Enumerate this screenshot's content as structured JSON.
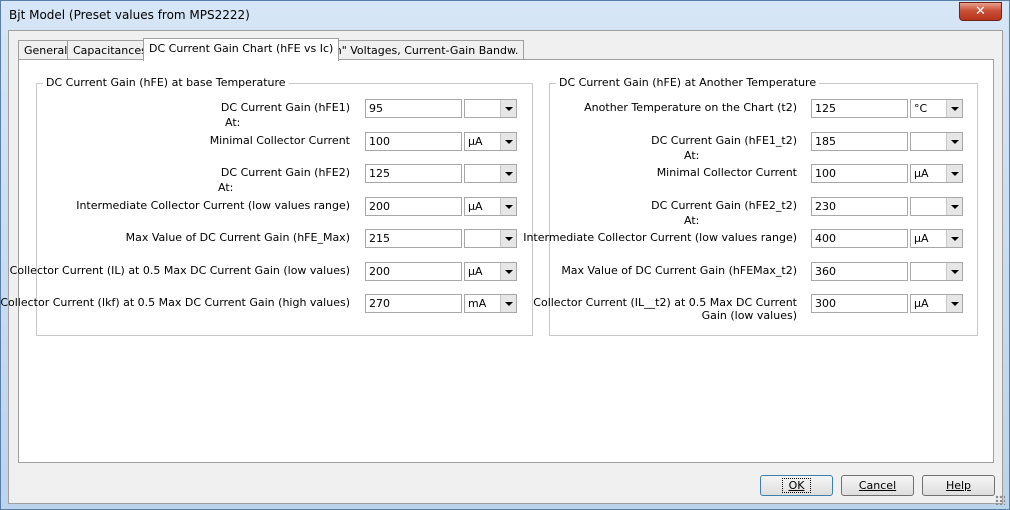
{
  "window": {
    "title": "Bjt Model (Preset values from MPS2222)",
    "close_glyph": "✕"
  },
  "tabs": [
    {
      "label": "General"
    },
    {
      "label": "Capacitances"
    },
    {
      "label": "DC Current Gain Chart (hFE vs Ic)"
    },
    {
      "label": "\"On\" Voltages, Current-Gain Bandw."
    }
  ],
  "left_group": {
    "title": "DC Current Gain (hFE) at base Temperature",
    "rows": [
      {
        "label": "DC Current Gain (hFE1)",
        "value": "95",
        "unit": ""
      },
      {
        "label": "Minimal Collector Current",
        "value": "100",
        "unit": "µA"
      },
      {
        "label": "DC Current Gain (hFE2)",
        "value": "125",
        "unit": ""
      },
      {
        "label": "Intermediate Collector Current (low values range)",
        "value": "200",
        "unit": "µA"
      },
      {
        "label": "Max Value of DC Current Gain  (hFE_Max)",
        "value": "215",
        "unit": ""
      },
      {
        "label": "Collector Current (IL) at 0.5 Max DC Current Gain (low values)",
        "value": "200",
        "unit": "µA"
      },
      {
        "label": "Collector Current (Ikf) at 0.5 Max DC Current Gain (high values)",
        "value": "270",
        "unit": "mA"
      }
    ],
    "at_labels": [
      "At:",
      "At:"
    ]
  },
  "right_group": {
    "title": "DC Current Gain (hFE) at Another Temperature",
    "rows": [
      {
        "label": "Another Temperature on the Chart (t2)",
        "value": "125",
        "unit": "°C"
      },
      {
        "label": "DC Current Gain (hFE1_t2)",
        "value": "185",
        "unit": ""
      },
      {
        "label": "Minimal Collector Current",
        "value": "100",
        "unit": "µA"
      },
      {
        "label": "DC Current Gain (hFE2_t2)",
        "value": "230",
        "unit": ""
      },
      {
        "label": "Intermediate Collector Current (low values range)",
        "value": "400",
        "unit": "µA"
      },
      {
        "label": "Max Value of DC Current Gain (hFEMax_t2)",
        "value": "360",
        "unit": ""
      },
      {
        "label": "Collector Current (IL__t2) at 0.5 Max DC Current",
        "label2": "Gain (low values)",
        "value": "300",
        "unit": "µA"
      }
    ],
    "at_labels": [
      "At:",
      "At:"
    ]
  },
  "buttons": {
    "ok": "OK",
    "cancel": "Cancel",
    "help": "Help"
  }
}
